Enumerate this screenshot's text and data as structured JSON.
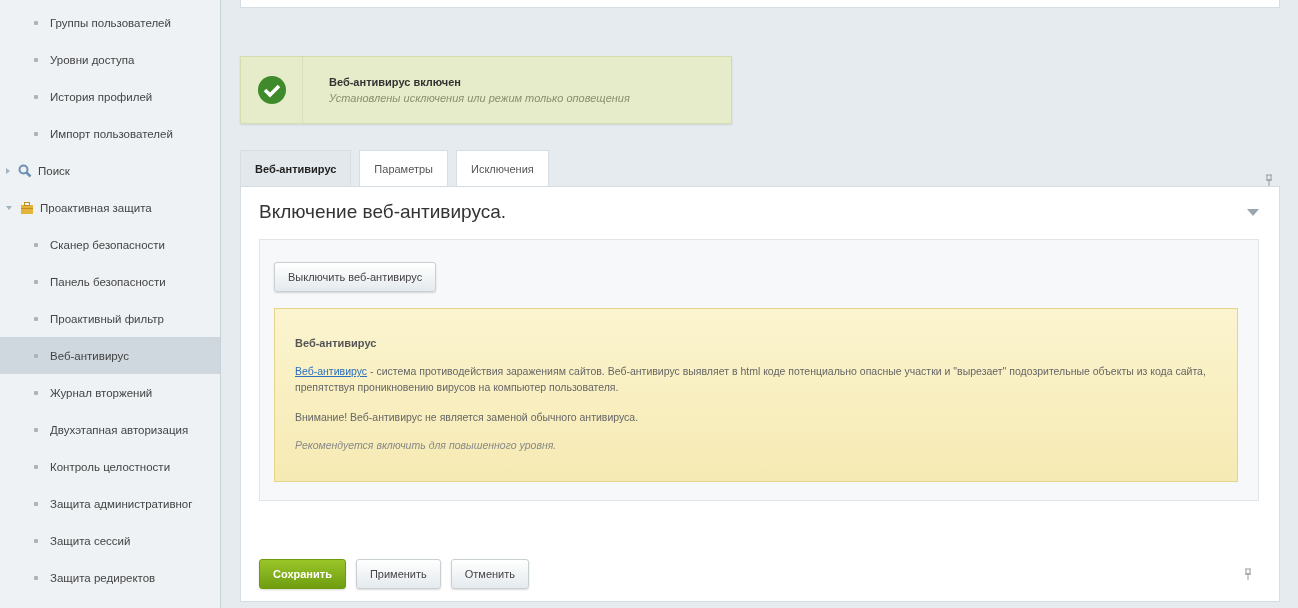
{
  "sidebar": {
    "items": [
      {
        "label": "Группы пользователей",
        "kind": "leaf",
        "selected": false
      },
      {
        "label": "Уровни доступа",
        "kind": "leaf",
        "selected": false
      },
      {
        "label": "История профилей",
        "kind": "leaf",
        "selected": false
      },
      {
        "label": "Импорт пользователей",
        "kind": "leaf",
        "selected": false
      },
      {
        "label": "Поиск",
        "kind": "search",
        "expanded": false,
        "selected": false
      },
      {
        "label": "Проактивная защита",
        "kind": "security",
        "expanded": true,
        "selected": false,
        "children": [
          {
            "label": "Сканер безопасности",
            "kind": "leaf",
            "selected": false
          },
          {
            "label": "Панель безопасности",
            "kind": "leaf",
            "selected": false
          },
          {
            "label": "Проактивный фильтр",
            "kind": "leaf",
            "selected": false
          },
          {
            "label": "Веб-антивирус",
            "kind": "leaf",
            "selected": true
          },
          {
            "label": "Журнал вторжений",
            "kind": "leaf",
            "selected": false
          },
          {
            "label": "Двухэтапная авторизация",
            "kind": "leaf",
            "selected": false
          },
          {
            "label": "Контроль целостности",
            "kind": "leaf",
            "selected": false
          },
          {
            "label": "Защита административног",
            "kind": "leaf",
            "selected": false
          },
          {
            "label": "Защита сессий",
            "kind": "leaf",
            "selected": false
          },
          {
            "label": "Защита редиректов",
            "kind": "leaf",
            "selected": false
          }
        ]
      }
    ]
  },
  "notice": {
    "title": "Веб-антивирус включен",
    "text": "Установлены исключения или режим только оповещения"
  },
  "tabs": [
    {
      "label": "Веб-антивирус",
      "selected": true
    },
    {
      "label": "Параметры",
      "selected": false
    },
    {
      "label": "Исключения",
      "selected": false
    }
  ],
  "panel": {
    "title": "Включение веб-антивируса.",
    "expanded": true,
    "action_button": "Выключить веб-антивирус",
    "info": {
      "heading": "Веб-антивирус",
      "link": "Веб-антивирус",
      "description": " - система противодействия заражениям сайтов. Веб-антивирус выявляет в html коде потенциально опасные участки и \"вырезает\" подозрительные объекты из кода сайта, препятствуя проникновению вирусов на компьютер пользователя.",
      "warning": "Внимание! Веб-антивирус не является заменой обычного антивируса.",
      "recommendation": "Рекомендуется включить для повышенного уровня."
    }
  },
  "footer": {
    "buttons": [
      {
        "label": "Сохранить",
        "kind": "primary"
      },
      {
        "label": "Применить",
        "kind": "normal"
      },
      {
        "label": "Отменить",
        "kind": "normal"
      }
    ]
  }
}
